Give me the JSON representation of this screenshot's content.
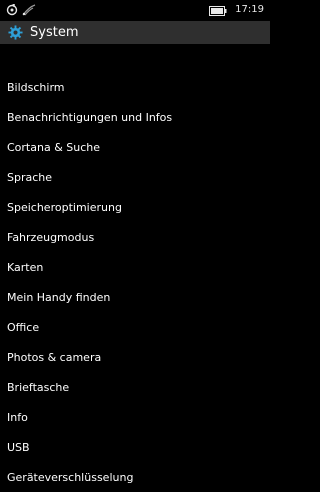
{
  "status_bar": {
    "time": "17:19",
    "icons": [
      "sync-icon",
      "signal-icon",
      "battery-icon"
    ]
  },
  "header": {
    "icon": "gear-icon",
    "accent_color": "#2ea0d8",
    "title": "System"
  },
  "menu": {
    "items": [
      {
        "label": "Bildschirm"
      },
      {
        "label": "Benachrichtigungen und Infos"
      },
      {
        "label": "Cortana & Suche"
      },
      {
        "label": "Sprache"
      },
      {
        "label": "Speicheroptimierung"
      },
      {
        "label": "Fahrzeugmodus"
      },
      {
        "label": "Karten"
      },
      {
        "label": "Mein Handy finden"
      },
      {
        "label": "Office"
      },
      {
        "label": "Photos & camera"
      },
      {
        "label": "Brieftasche"
      },
      {
        "label": "Info"
      },
      {
        "label": "USB"
      },
      {
        "label": "Geräteverschlüsselung"
      }
    ]
  }
}
